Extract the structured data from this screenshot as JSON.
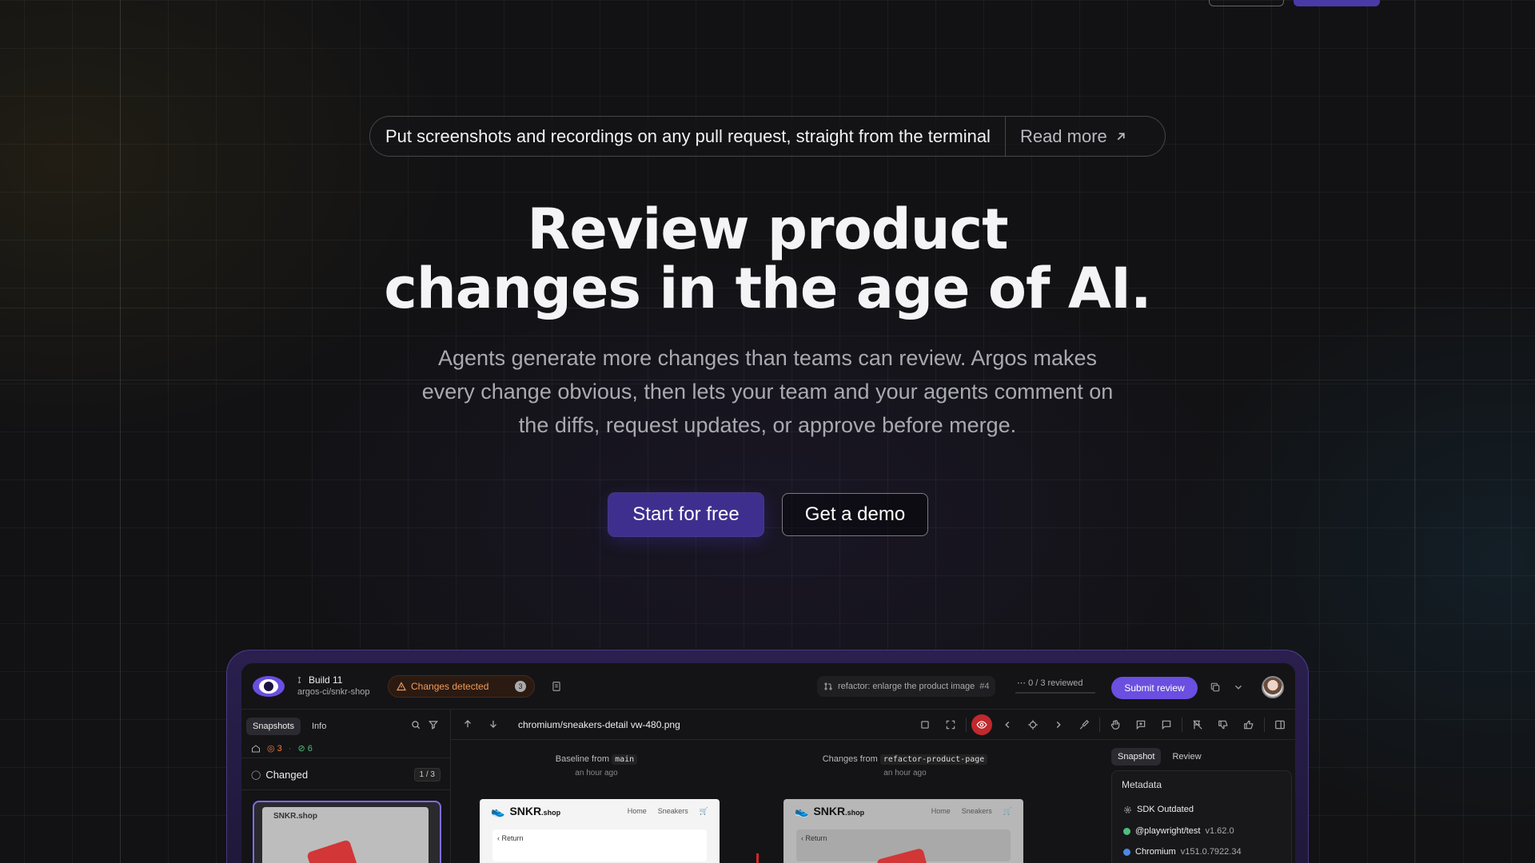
{
  "announcement": {
    "text": "Put screenshots and recordings on any pull request, straight from the terminal",
    "link": "Read more"
  },
  "hero": {
    "title_line1": "Review product",
    "title_line2": "changes in the age of AI.",
    "subtitle": "Agents generate more changes than teams can review. Argos makes every change obvious, then lets your team and your agents comment on the diffs, request updates, or approve before merge."
  },
  "cta": {
    "primary": "Start for free",
    "secondary": "Get a demo"
  },
  "app": {
    "build_title": "Build 11",
    "build_sub": "argos-ci/snkr-shop",
    "changes_badge": "Changes detected",
    "changes_count": "3",
    "pr_title": "refactor: enlarge the product image",
    "pr_number": "#4",
    "reviewed": "0 / 3 reviewed",
    "submit": "Submit review",
    "sidebar": {
      "tabs": [
        "Snapshots",
        "Info"
      ],
      "stat_changed": "3",
      "stat_ok": "6",
      "group_label": "Changed",
      "group_pagination": "1 / 3",
      "thumb_brand": "SNKR.shop"
    },
    "filename": "chromium/sneakers-detail vw-480.png",
    "baseline": {
      "label": "Baseline from",
      "branch": "main",
      "ago": "an hour ago"
    },
    "changes": {
      "label": "Changes from",
      "branch": "refactor-product-page",
      "ago": "an hour ago"
    },
    "shot": {
      "brand": "SNKR",
      "brand_suffix": ".shop",
      "nav_home": "Home",
      "nav_sneakers": "Sneakers",
      "return": "‹ Return"
    },
    "right_panel": {
      "tabs": [
        "Snapshot",
        "Review"
      ],
      "metadata_title": "Metadata",
      "rows": [
        {
          "name": "SDK Outdated",
          "version": ""
        },
        {
          "name": "@playwright/test",
          "version": "v1.62.0"
        },
        {
          "name": "Chromium",
          "version": "v151.0.7922.34"
        }
      ]
    }
  },
  "colors": {
    "accent": "#3e2f8f",
    "submit": "#6a4fe0",
    "warning": "#f39a5a",
    "success": "#4cc07a",
    "danger": "#c0292d"
  }
}
